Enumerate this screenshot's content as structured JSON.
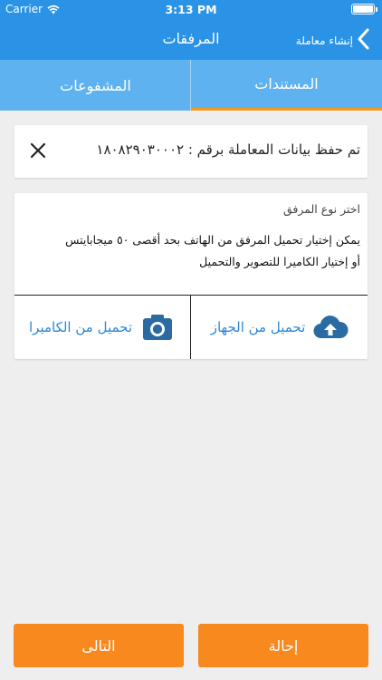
{
  "status_bar": {
    "carrier": "Carrier",
    "time": "3:13 PM"
  },
  "nav": {
    "title": "المرفقات",
    "back_label": "إنشاء معاملة"
  },
  "tabs": [
    {
      "label": "المستندات",
      "active": true
    },
    {
      "label": "المشفوعات",
      "active": false
    }
  ],
  "toast": {
    "message": "تم حفظ بيانات المعاملة برقم : ١٨٠٨٢٩٠٣٠٠٠٢"
  },
  "attachment_card": {
    "title": "اختر نوع المرفق",
    "description_line1": "يمكن إختيار تحميل المرفق من الهاتف بحد أقصى ٥٠ ميجابايتس",
    "description_line2": "أو إختيار الكاميرا للتصوير والتحميل",
    "upload_from_device": "تحميل من الجهاز",
    "upload_from_camera": "تحميل من الكاميرا"
  },
  "footer": {
    "refer_label": "إحالة",
    "next_label": "التالى"
  },
  "colors": {
    "primary": "#2b93e6",
    "tab_bg": "#5fb2f0",
    "accent": "#f7891e",
    "link": "#2b88d8"
  },
  "icons": [
    "wifi-icon",
    "battery-icon",
    "back-chevron-icon",
    "close-icon",
    "cloud-upload-icon",
    "camera-icon"
  ]
}
